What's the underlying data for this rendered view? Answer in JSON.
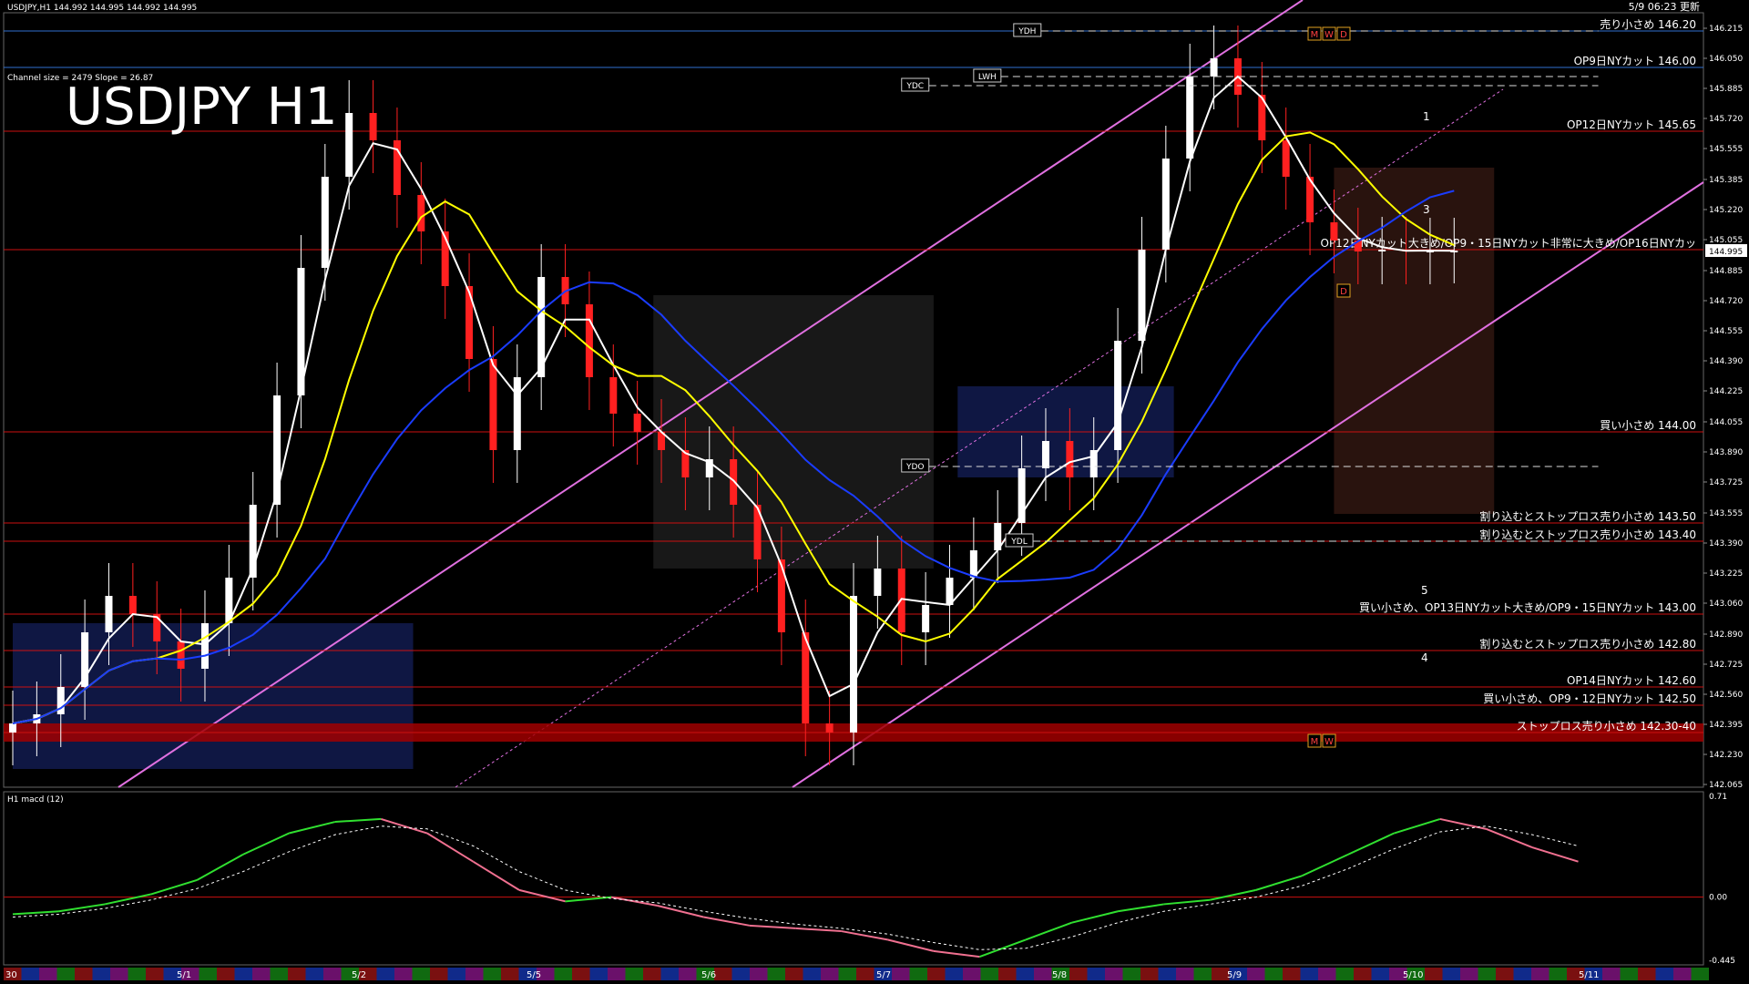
{
  "header": {
    "symbol_info": "USDJPY,H1  144.992 144.995 144.992 144.995",
    "updated": "5/9 06:23 更新",
    "channel_info": "Channel size = 2479 Slope = 26.87",
    "big_title": "USDJPY H1",
    "macd_label": "H1  macd (12)"
  },
  "chart_data": [
    {
      "type": "line",
      "title": "USDJPY H1",
      "ylim": [
        142.05,
        146.3
      ],
      "y_ticks": [
        "146.215",
        "146.050",
        "145.885",
        "145.720",
        "145.555",
        "145.385",
        "145.220",
        "145.055",
        "144.885",
        "144.720",
        "144.555",
        "144.390",
        "144.225",
        "144.055",
        "143.890",
        "143.725",
        "143.555",
        "143.390",
        "143.225",
        "143.060",
        "142.890",
        "142.725",
        "142.560",
        "142.395",
        "142.230",
        "142.065"
      ],
      "current_price": "144.995",
      "x_ticks": [
        "30",
        "5/1",
        "5/2",
        "5/5",
        "5/6",
        "5/7",
        "5/8",
        "5/9",
        "5/10",
        "5/11"
      ],
      "levels": [
        {
          "price": 146.2,
          "label": "売り小さめ 146.20",
          "color": "#2f6fd0"
        },
        {
          "price": 146.0,
          "label": "OP9日NYカット 146.00",
          "color": "#2f6fd0"
        },
        {
          "price": 145.65,
          "label": "OP12日NYカット 145.65",
          "color": "#cc1010"
        },
        {
          "price": 145.0,
          "label": "OP12日NYカット大きめ/OP9・15日NYカット非常に大きめ/OP16日NYカッ",
          "color": "#cc1010"
        },
        {
          "price": 144.0,
          "label": "買い小さめ 144.00",
          "color": "#cc1010"
        },
        {
          "price": 143.5,
          "label": "割り込むとストップロス売り小さめ 143.50",
          "color": "#cc1010"
        },
        {
          "price": 143.4,
          "label": "割り込むとストップロス売り小さめ 143.40",
          "color": "#cc1010"
        },
        {
          "price": 143.0,
          "label": "買い小さめ、OP13日NYカット大きめ/OP9・15日NYカット 143.00",
          "color": "#cc1010"
        },
        {
          "price": 142.8,
          "label": "割り込むとストップロス売り小さめ 142.80",
          "color": "#cc1010"
        },
        {
          "price": 142.6,
          "label": "OP14日NYカット 142.60",
          "color": "#cc1010"
        },
        {
          "price": 142.5,
          "label": "買い小さめ、OP9・12日NYカット 142.50",
          "color": "#cc1010"
        },
        {
          "price": 142.35,
          "label": "ストップロス売り小さめ 142.30-40",
          "color": "#cc1010",
          "band": [
            142.3,
            142.4
          ]
        }
      ],
      "markers": [
        {
          "label": "YDH",
          "price": 146.2
        },
        {
          "label": "LWH",
          "price": 145.95
        },
        {
          "label": "YDC",
          "price": 145.9
        },
        {
          "label": "YDO",
          "price": 143.81
        },
        {
          "label": "YDL",
          "price": 143.4
        }
      ],
      "wave_labels": [
        "1",
        "3",
        "5",
        "4"
      ],
      "badges": {
        "m": "M",
        "w": "W",
        "d": "D"
      },
      "series": [
        {
          "name": "USDJPY",
          "x": [
            0,
            6,
            12,
            18,
            24,
            30,
            36,
            42,
            48,
            54,
            60,
            66,
            72,
            78,
            84,
            90,
            96,
            102,
            108,
            114,
            120,
            126,
            132,
            138,
            144,
            150,
            156,
            162,
            168,
            174,
            180,
            186,
            192,
            198,
            204,
            210,
            216,
            222,
            228,
            234,
            240,
            246,
            252,
            258,
            264,
            270,
            276,
            282,
            288,
            294,
            300,
            306,
            312,
            318,
            324,
            330,
            336,
            342,
            348,
            354,
            360
          ],
          "close": [
            142.4,
            142.45,
            142.6,
            142.9,
            143.1,
            143.0,
            142.85,
            142.7,
            142.95,
            143.2,
            143.6,
            144.2,
            144.9,
            145.4,
            145.75,
            145.6,
            145.3,
            145.1,
            144.8,
            144.4,
            143.9,
            144.3,
            144.85,
            144.7,
            144.3,
            144.1,
            144.0,
            143.9,
            143.75,
            143.85,
            143.6,
            143.3,
            142.9,
            142.4,
            142.35,
            143.1,
            143.25,
            142.9,
            143.05,
            143.2,
            143.35,
            143.5,
            143.8,
            143.95,
            143.75,
            143.9,
            144.5,
            145.0,
            145.5,
            145.95,
            146.05,
            145.85,
            145.6,
            145.4,
            145.15,
            145.05,
            144.99,
            145.0,
            144.99,
            144.995,
            144.995
          ],
          "high_offset": 0.18,
          "low_offset": 0.18
        },
        {
          "name": "MA fast",
          "color": "#ffffff"
        },
        {
          "name": "MA mid",
          "color": "#ffff00"
        },
        {
          "name": "MA slow",
          "color": "#1a3cff"
        }
      ]
    },
    {
      "type": "line",
      "title": "H1  macd (12)",
      "ylim": [
        -0.445,
        0.71
      ],
      "y_ticks": [
        "0.71",
        "0.00",
        "-0.445"
      ],
      "series": [
        {
          "name": "macd",
          "x": [
            0,
            10,
            20,
            30,
            40,
            50,
            60,
            70,
            80,
            90,
            100,
            110,
            120,
            130,
            140,
            150,
            160,
            170,
            180,
            190,
            200,
            210,
            220,
            230,
            240,
            250,
            260,
            270,
            280,
            290,
            300,
            310,
            320,
            330,
            340
          ],
          "values": [
            -0.12,
            -0.1,
            -0.05,
            0.02,
            0.12,
            0.3,
            0.45,
            0.53,
            0.55,
            0.45,
            0.25,
            0.05,
            -0.03,
            0.0,
            -0.06,
            -0.14,
            -0.2,
            -0.22,
            -0.24,
            -0.3,
            -0.38,
            -0.42,
            -0.3,
            -0.18,
            -0.1,
            -0.05,
            -0.02,
            0.05,
            0.15,
            0.3,
            0.45,
            0.55,
            0.48,
            0.35,
            0.25
          ]
        },
        {
          "name": "signal",
          "x": [
            0,
            10,
            20,
            30,
            40,
            50,
            60,
            70,
            80,
            90,
            100,
            110,
            120,
            130,
            140,
            150,
            160,
            170,
            180,
            190,
            200,
            210,
            220,
            230,
            240,
            250,
            260,
            270,
            280,
            290,
            300,
            310,
            320,
            330,
            340
          ],
          "values": [
            -0.14,
            -0.12,
            -0.08,
            -0.02,
            0.06,
            0.18,
            0.32,
            0.44,
            0.5,
            0.48,
            0.36,
            0.18,
            0.05,
            -0.01,
            -0.04,
            -0.1,
            -0.15,
            -0.19,
            -0.22,
            -0.26,
            -0.32,
            -0.37,
            -0.36,
            -0.28,
            -0.18,
            -0.1,
            -0.05,
            0.0,
            0.08,
            0.2,
            0.34,
            0.46,
            0.5,
            0.44,
            0.36
          ]
        }
      ]
    }
  ]
}
